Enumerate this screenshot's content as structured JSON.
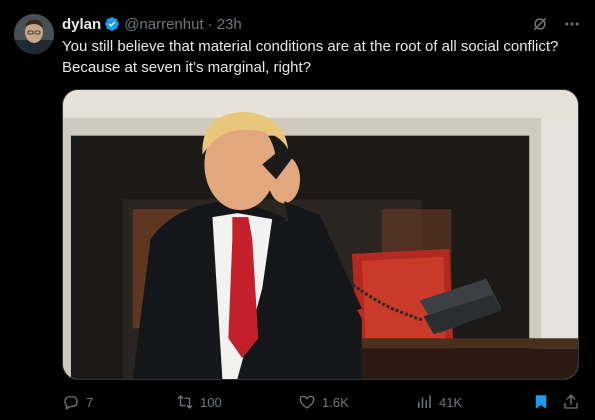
{
  "tweet": {
    "author_name": "dylan",
    "author_handle": "@narrenhut",
    "separator": "·",
    "timestamp": "23h",
    "text": "You still believe that material conditions are at the root of all social conflict?\nBecause at seven it’s marginal, right?",
    "verified": true
  },
  "counts": {
    "replies": "7",
    "retweets": "100",
    "likes": "1.6K",
    "views": "41K"
  },
  "colors": {
    "background": "#000000",
    "text": "#e7e9ea",
    "muted": "#71767b",
    "verified_blue": "#1d9bf0",
    "bookmark_blue": "#1d9bf0"
  },
  "icons": {
    "grok": "grok-icon",
    "more": "more-icon",
    "reply": "reply-icon",
    "retweet": "retweet-icon",
    "like": "heart-icon",
    "views": "views-icon",
    "bookmark": "bookmark-icon",
    "share": "share-icon"
  }
}
